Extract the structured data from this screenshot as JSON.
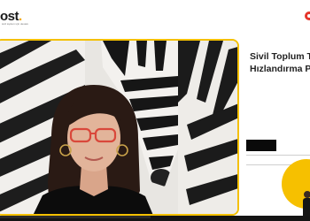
{
  "header": {
    "logo_text": "ost",
    "logo_dot": ".",
    "logo_subtitle": "sivil toplum için destek"
  },
  "slide": {
    "title_line_1": "Sivil Toplum T",
    "title_line_2": "Hızlandırma P"
  },
  "colors": {
    "accent_yellow": "#f4c000",
    "brand_red": "#e5352b"
  },
  "icons": {
    "brand_mark": "red-ring-logo-icon"
  }
}
